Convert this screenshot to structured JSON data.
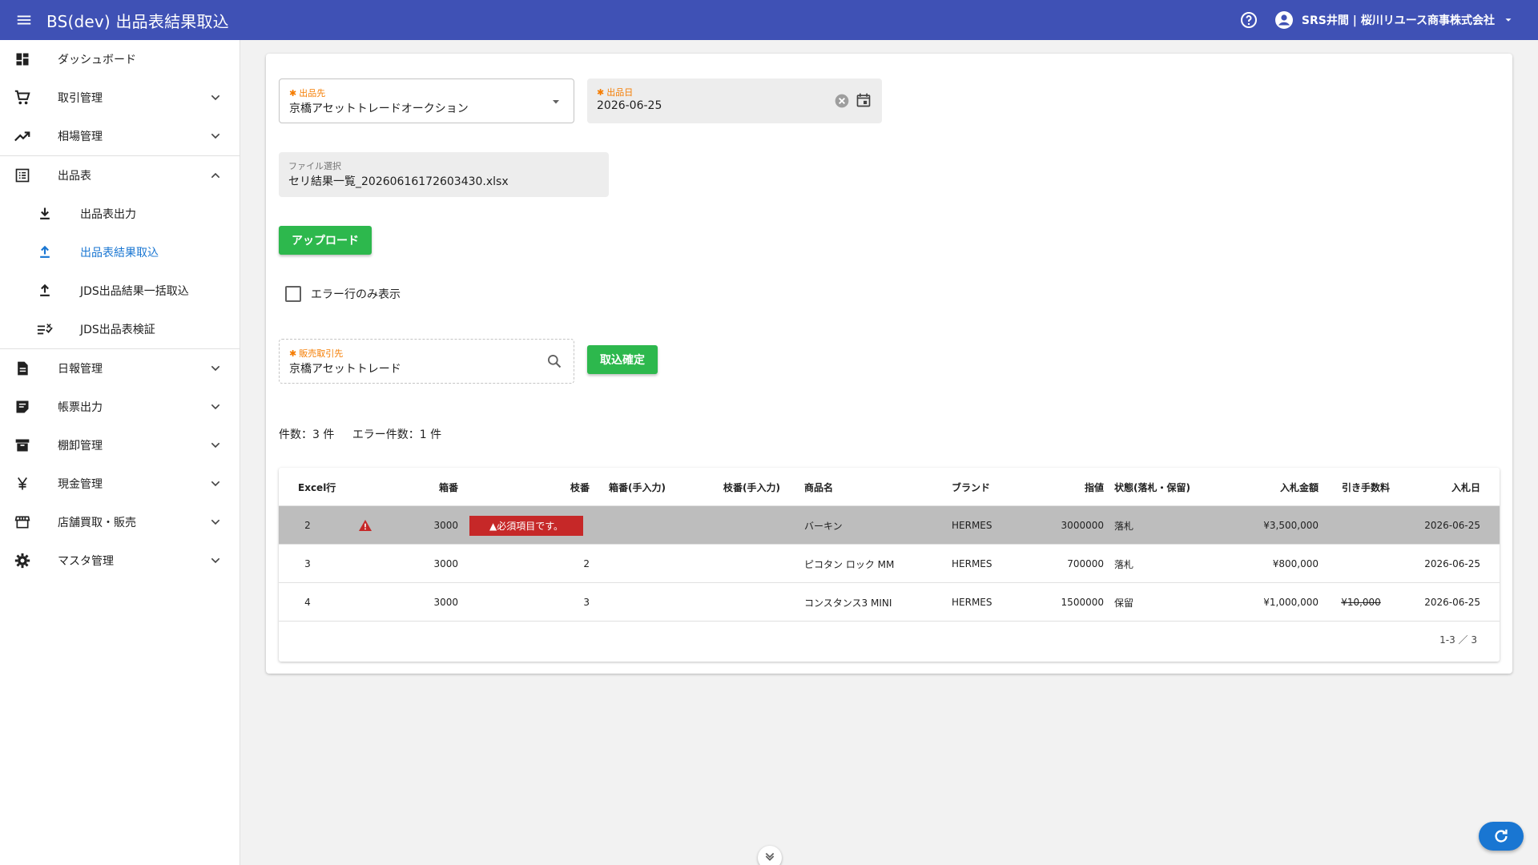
{
  "header": {
    "title": "BS(dev) 出品表結果取込",
    "account_label": "SRS井間 | 桜川リユース商事株式会社"
  },
  "sidebar": {
    "items": [
      {
        "label": "ダッシュボード",
        "icon": "dashboard-icon"
      },
      {
        "label": "取引管理",
        "icon": "cart-icon"
      },
      {
        "label": "相場管理",
        "icon": "trending-up-icon"
      },
      {
        "label": "出品表",
        "icon": "list-icon"
      },
      {
        "label": "日報管理",
        "icon": "document-icon"
      },
      {
        "label": "帳票出力",
        "icon": "form-icon"
      },
      {
        "label": "棚卸管理",
        "icon": "archive-icon"
      },
      {
        "label": "現金管理",
        "icon": "yen-icon"
      },
      {
        "label": "店舗買取・販売",
        "icon": "store-icon"
      },
      {
        "label": "マスタ管理",
        "icon": "gear-icon"
      }
    ],
    "sub_items": [
      {
        "label": "出品表出力",
        "icon": "download-icon"
      },
      {
        "label": "出品表結果取込",
        "icon": "upload-icon"
      },
      {
        "label": "JDS出品結果一括取込",
        "icon": "upload-icon"
      },
      {
        "label": "JDS出品表検証",
        "icon": "checklist-icon"
      }
    ]
  },
  "form": {
    "exhibit_to_label": "出品先",
    "exhibit_to_value": "京橋アセットトレードオークション",
    "exhibit_date_label": "出品日",
    "exhibit_date_value": "2026-06-25",
    "file_label": "ファイル選択",
    "file_value": "セリ結果一覧_20260616172603430.xlsx",
    "upload_button": "アップロード",
    "error_only_label": "エラー行のみ表示",
    "partner_label": "販売取引先",
    "partner_value": "京橋アセットトレード",
    "confirm_button": "取込確定",
    "count_text": "件数：3 件",
    "error_count_text": "エラー件数：1 件"
  },
  "table": {
    "headers": [
      "Excel行",
      "",
      "箱番",
      "枝番",
      "箱番(手入力)",
      "枝番(手入力)",
      "商品名",
      "ブランド",
      "指値",
      "状態(落札・保留)",
      "入札金額",
      "引き手数料",
      "入札日"
    ],
    "rows": [
      {
        "excel_row": "2",
        "box": "3000",
        "branch": "",
        "error_msg": "▲必須項目です。",
        "name": "バーキン",
        "brand": "HERMES",
        "limit": "3000000",
        "status": "落札",
        "bid": "¥3,500,000",
        "fee": "",
        "date": "2026-06-25"
      },
      {
        "excel_row": "3",
        "box": "3000",
        "branch": "2",
        "error_msg": "",
        "name": "ピコタン ロック MM",
        "brand": "HERMES",
        "limit": "700000",
        "status": "落札",
        "bid": "¥800,000",
        "fee": "",
        "date": "2026-06-25"
      },
      {
        "excel_row": "4",
        "box": "3000",
        "branch": "3",
        "error_msg": "",
        "name": "コンスタンス3 MINI",
        "brand": "HERMES",
        "limit": "1500000",
        "status": "保留",
        "bid": "¥1,000,000",
        "fee": "¥10,000",
        "date": "2026-06-25"
      }
    ],
    "pager": "1-3 ／ 3"
  },
  "colors": {
    "appbar": "#3f51b5",
    "accent_green": "#2db84d",
    "error_red": "#c62828",
    "active_blue": "#1976d2",
    "required_orange": "#f57c00"
  }
}
